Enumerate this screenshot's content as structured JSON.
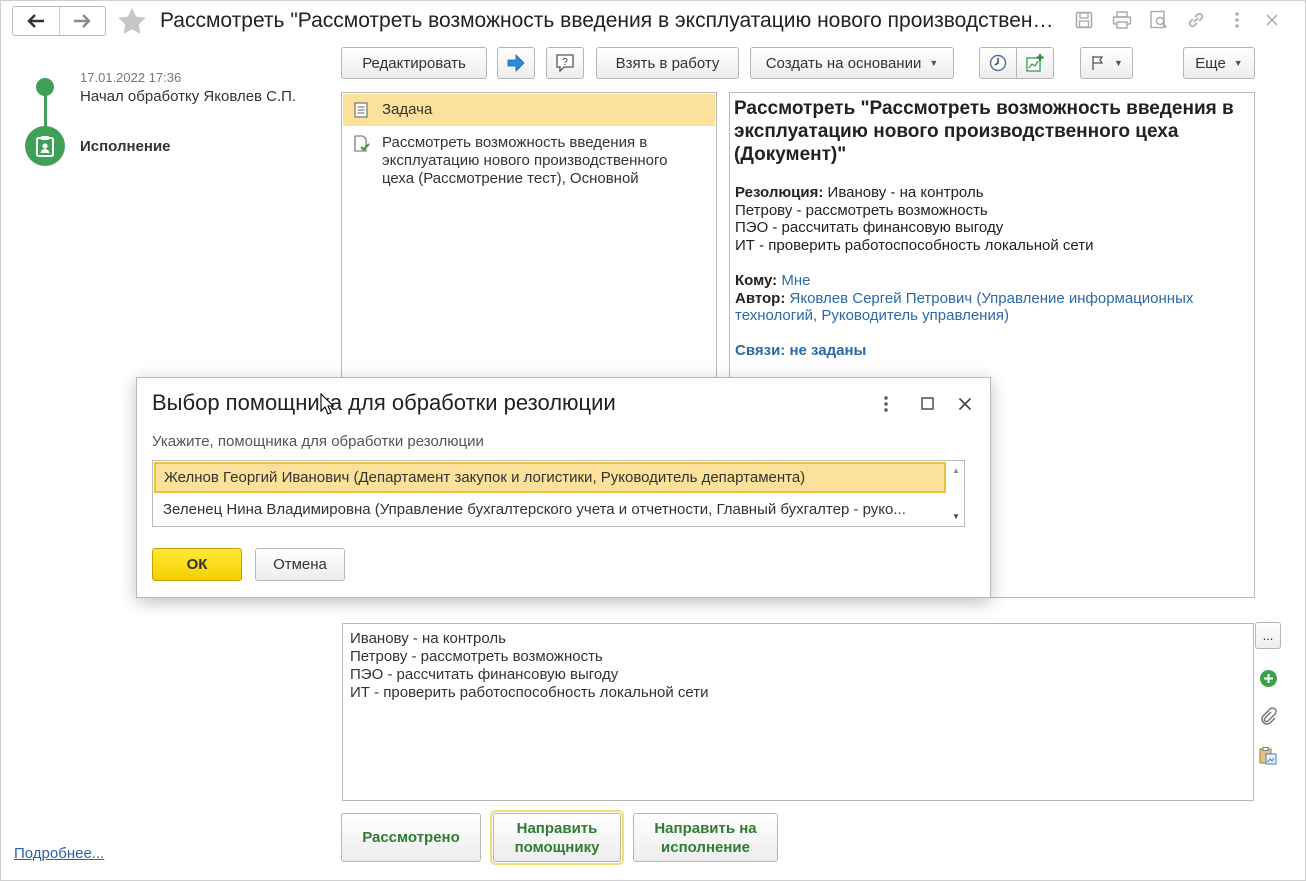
{
  "window": {
    "title": "Рассмотреть \"Рассмотреть возможность введения в эксплуатацию нового производственного цеха (Документ)\""
  },
  "timeline": {
    "date": "17.01.2022 17:36",
    "event": "Начал обработку Яковлев С.П.",
    "current_step": "Исполнение"
  },
  "more_link": "Подробнее...",
  "toolbar": {
    "edit": "Редактировать",
    "take_to_work": "Взять в работу",
    "create_based_on": "Создать на основании",
    "more": "Еще"
  },
  "tree": {
    "root": "Задача",
    "child": "Рассмотреть возможность введения в эксплуатацию нового производственного цеха (Рассмотрение тест), Основной"
  },
  "document": {
    "title": "Рассмотреть \"Рассмотреть возможность введения в эксплуатацию нового производственного цеха (Документ)\"",
    "resolution_label": "Резолюция:",
    "resolution_line1": "Иванову - на контроль",
    "resolution_line2": "Петрову - рассмотреть возможность",
    "resolution_line3": "ПЭО - рассчитать финансовую выгоду",
    "resolution_line4": "ИТ - проверить работоспособность локальной сети",
    "to_label": "Кому:",
    "to_value": "Мне",
    "author_label": "Автор:",
    "author_value": "Яковлев Сергей Петрович (Управление информационных технологий, Руководитель управления)",
    "links": "Связи: не заданы"
  },
  "dialog": {
    "title": "Выбор помощника для обработки резолюции",
    "subtitle": "Укажите, помощника для обработки резолюции",
    "options": [
      "Желнов Георгий Иванович (Департамент закупок и логистики, Руководитель департамента)",
      "Зеленец Нина Владимировна (Управление бухгалтерского учета и отчетности, Главный бухгалтер - руко..."
    ],
    "ok": "ОК",
    "cancel": "Отмена"
  },
  "resolution_text": {
    "line1": "Иванову - на контроль",
    "line2": "Петрову - рассмотреть возможность",
    "line3": "ПЭО - рассчитать финансовую выгоду",
    "line4": "ИТ - проверить работоспособность локальной сети",
    "ellipsis_button": "..."
  },
  "actions": {
    "reviewed": "Рассмотрено",
    "to_assistant_1": "Направить",
    "to_assistant_2": "помощнику",
    "to_execution_1": "Направить на",
    "to_execution_2": "исполнение"
  },
  "colors": {
    "accent_green": "#3fa057",
    "selection_yellow": "#fbe19a",
    "ok_yellow": "#f2cf00",
    "link_blue": "#2b6aa6"
  }
}
